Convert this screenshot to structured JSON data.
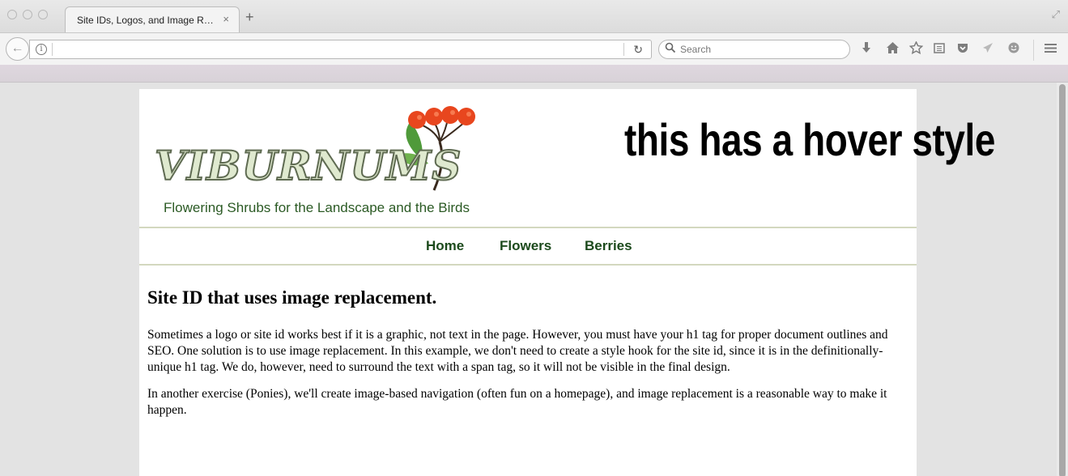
{
  "browser": {
    "tab_title": "Site IDs, Logos, and Image Re...",
    "tab_close": "×",
    "new_tab": "+",
    "back": "←",
    "info": "i",
    "reload": "↻",
    "search_placeholder": "Search",
    "url": "",
    "toolbar_icons": [
      "download-icon",
      "home-icon",
      "bookmark-star-icon",
      "reading-list-icon",
      "pocket-icon",
      "share-icon",
      "emoji-icon",
      "menu-icon"
    ]
  },
  "page": {
    "hover_text": "this has a hover style",
    "logo": {
      "word": "VIBURNUMS",
      "tagline": "Flowering Shrubs for the Landscape and the Birds"
    },
    "nav": {
      "items": [
        {
          "label": "Home"
        },
        {
          "label": "Flowers"
        },
        {
          "label": "Berries"
        }
      ]
    },
    "content": {
      "heading": "Site ID that uses image replacement.",
      "paragraphs": [
        "Sometimes a logo or site id works best if it is a graphic, not text in the page. However, you must have your h1 tag for proper document outlines and SEO. One solution is to use image replacement. In this example, we don't need to create a style hook for the site id, since it is in the definitionally-unique h1 tag. We do, however, need to surround the text with a span tag, so it will not be visible in the final design.",
        "In another exercise (Ponies), we'll create image-based navigation (often fun on a homepage), and image replacement is a reasonable way to make it happen."
      ]
    }
  },
  "colors": {
    "nav_text": "#1c4a1c",
    "tagline": "#2b5a24",
    "berry": "#e8461e",
    "leaf": "#4f9a3a",
    "nav_border": "#d3d8bf"
  }
}
